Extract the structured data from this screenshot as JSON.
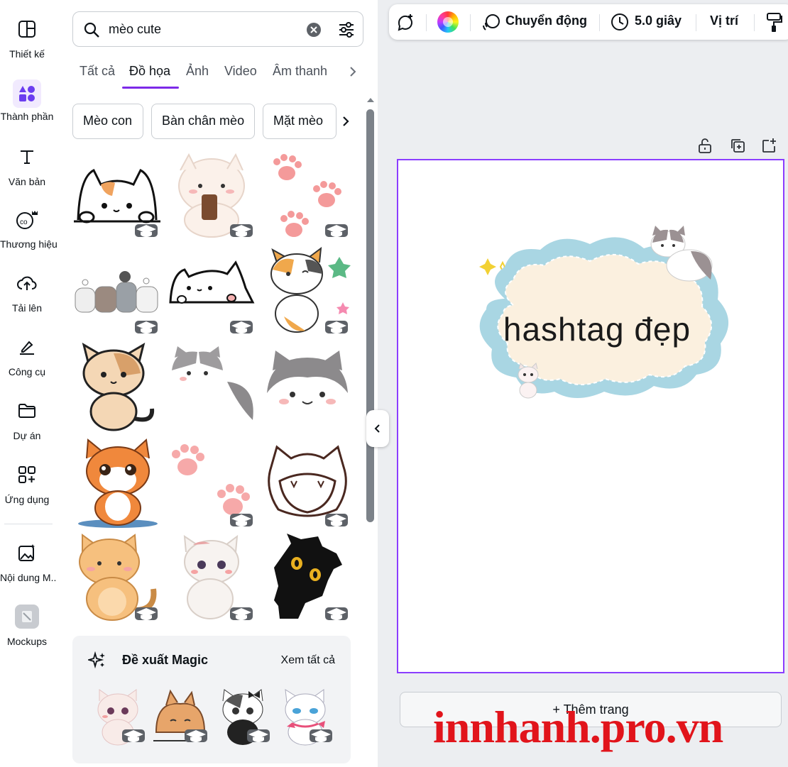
{
  "sidebar": {
    "items": [
      {
        "label": "Thiết kế",
        "icon": "layout-icon"
      },
      {
        "label": "Thành phần",
        "icon": "shapes-icon"
      },
      {
        "label": "Văn bản",
        "icon": "text-icon"
      },
      {
        "label": "Thương hiệu",
        "icon": "brand-icon"
      },
      {
        "label": "Tải lên",
        "icon": "upload-cloud-icon"
      },
      {
        "label": "Công cụ",
        "icon": "draw-icon"
      },
      {
        "label": "Dự án",
        "icon": "folder-icon"
      },
      {
        "label": "Ứng dụng",
        "icon": "apps-icon"
      },
      {
        "label": "Nội dung M...",
        "icon": "magic-media-icon"
      },
      {
        "label": "Mockups",
        "icon": "mockups-icon"
      }
    ]
  },
  "search": {
    "value": "mèo cute"
  },
  "tabs": [
    "Tất cả",
    "Đồ họa",
    "Ảnh",
    "Video",
    "Âm thanh"
  ],
  "chips": [
    "Mèo con",
    "Bàn chân mèo",
    "Mặt mèo"
  ],
  "magic": {
    "title": "Đề xuất Magic",
    "see_all": "Xem tất cả"
  },
  "toolbar": {
    "animate": "Chuyển động",
    "duration": "5.0 giây",
    "position": "Vị trí"
  },
  "canvas": {
    "headline": "hashtag đẹp",
    "add_page": "Thêm trang"
  },
  "watermark": "innhanh.pro.vn",
  "colors": {
    "accent": "#8b3dff",
    "watermark": "#e1141b",
    "cloud_border": "#a9d6e3",
    "cloud_fill": "#fbf0df"
  }
}
